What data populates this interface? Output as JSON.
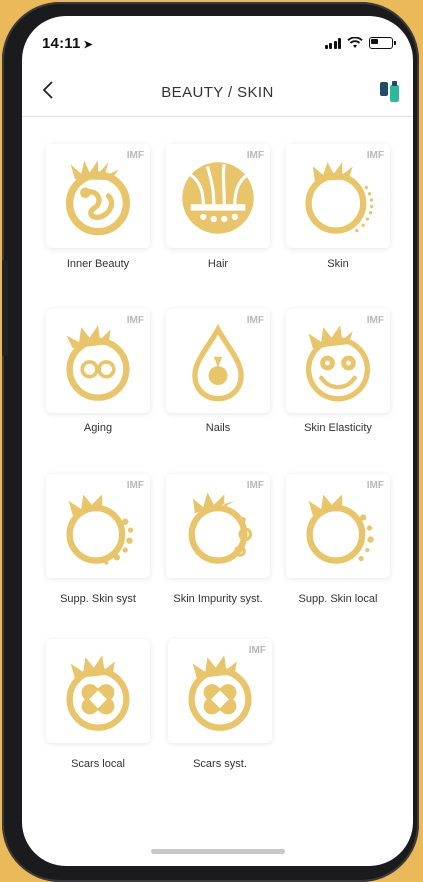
{
  "status": {
    "time": "14:11"
  },
  "nav": {
    "title": "BEAUTY / SKIN",
    "back_icon": "chevron-left-icon",
    "brand_icon": "app-logo-icon"
  },
  "accent": "#E8C46A",
  "items": [
    {
      "label": "Inner Beauty",
      "badge": "IMF",
      "icon": "inner-beauty-icon"
    },
    {
      "label": "Hair",
      "badge": "IMF",
      "icon": "hair-icon"
    },
    {
      "label": "Skin",
      "badge": "IMF",
      "icon": "skin-icon"
    },
    {
      "label": "Aging",
      "badge": "IMF",
      "icon": "aging-icon"
    },
    {
      "label": "Nails",
      "badge": "IMF",
      "icon": "nails-icon"
    },
    {
      "label": "Skin Elasticity",
      "badge": "IMF",
      "icon": "skin-elasticity-icon"
    },
    {
      "label": "Supp. Skin syst",
      "badge": "IMF",
      "icon": "supp-skin-syst-icon"
    },
    {
      "label": "Skin Impurity syst.",
      "badge": "IMF",
      "icon": "skin-impurity-icon"
    },
    {
      "label": "Supp. Skin local",
      "badge": "IMF",
      "icon": "supp-skin-local-icon"
    },
    {
      "label": "Scars local",
      "badge": "",
      "icon": "scars-local-icon"
    },
    {
      "label": "Scars syst.",
      "badge": "IMF",
      "icon": "scars-syst-icon"
    }
  ]
}
